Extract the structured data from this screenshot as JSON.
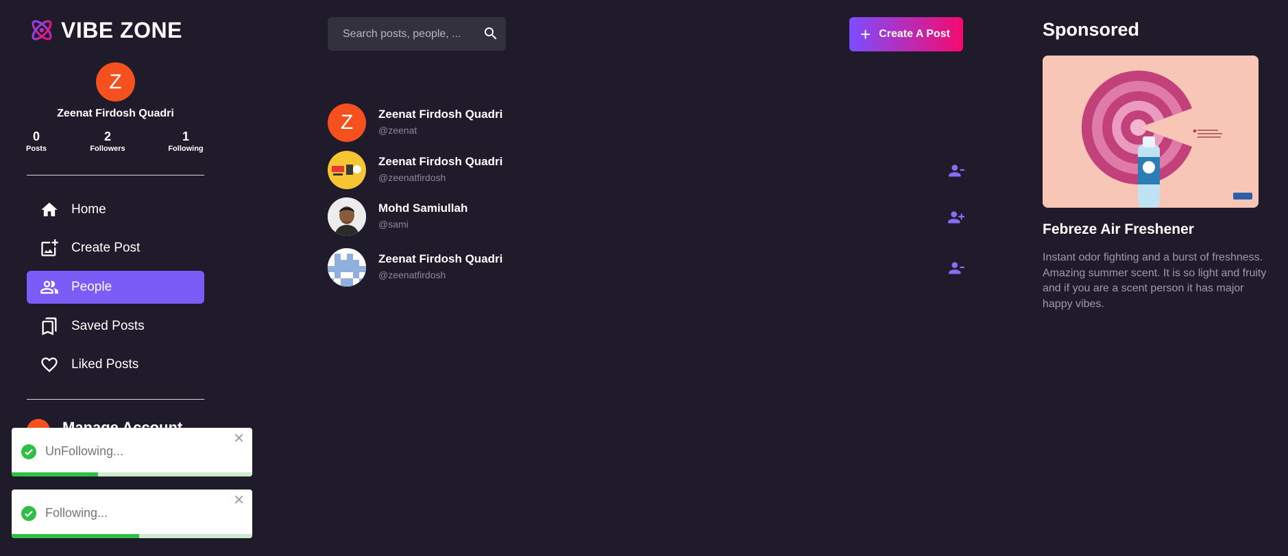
{
  "app": {
    "brand": "VIBE ZONE"
  },
  "profile": {
    "initial": "Z",
    "name": "Zeenat Firdosh Quadri",
    "stats": [
      {
        "value": "0",
        "label": "Posts"
      },
      {
        "value": "2",
        "label": "Followers"
      },
      {
        "value": "1",
        "label": "Following"
      }
    ]
  },
  "nav": [
    {
      "label": "Home",
      "icon": "home-icon"
    },
    {
      "label": "Create Post",
      "icon": "add-photo-icon"
    },
    {
      "label": "People",
      "icon": "people-icon",
      "active": true
    },
    {
      "label": "Saved Posts",
      "icon": "bookmarks-icon"
    },
    {
      "label": "Liked Posts",
      "icon": "heart-icon"
    }
  ],
  "account_peek": {
    "label": "Manage Account"
  },
  "toasts": [
    {
      "message": "UnFollowing...",
      "progress": 0.36
    },
    {
      "message": "Following...",
      "progress": 0.53
    }
  ],
  "search": {
    "placeholder": "Search posts, people, ..."
  },
  "create_button": {
    "label": "Create A Post"
  },
  "people": [
    {
      "name": "Zeenat Firdosh Quadri",
      "handle": "@zeenat",
      "avatar": "initial",
      "initial": "Z",
      "action": null
    },
    {
      "name": "Zeenat Firdosh Quadri",
      "handle": "@zeenatfirdosh",
      "avatar": "sale-banner",
      "action": "unfollow"
    },
    {
      "name": "Mohd Samiullah",
      "handle": "@sami",
      "avatar": "photo",
      "action": "follow"
    },
    {
      "name": "Zeenat Firdosh Quadri",
      "handle": "@zeenatfirdosh",
      "avatar": "pixel-pattern",
      "action": "unfollow"
    }
  ],
  "sponsored": {
    "title": "Sponsored",
    "product": "Febreze Air Freshener",
    "description": "Instant odor fighting and a burst of freshness. Amazing summer scent. It is so light and fruity and if you are a scent person it has major happy vibes."
  },
  "colors": {
    "background": "#1f1b2b",
    "accent": "#7b5cf6",
    "avatar_orange": "#f4511e",
    "gradient_start": "#7c4dff",
    "gradient_end": "#f50a6e",
    "toast_success": "#2fbf46"
  }
}
